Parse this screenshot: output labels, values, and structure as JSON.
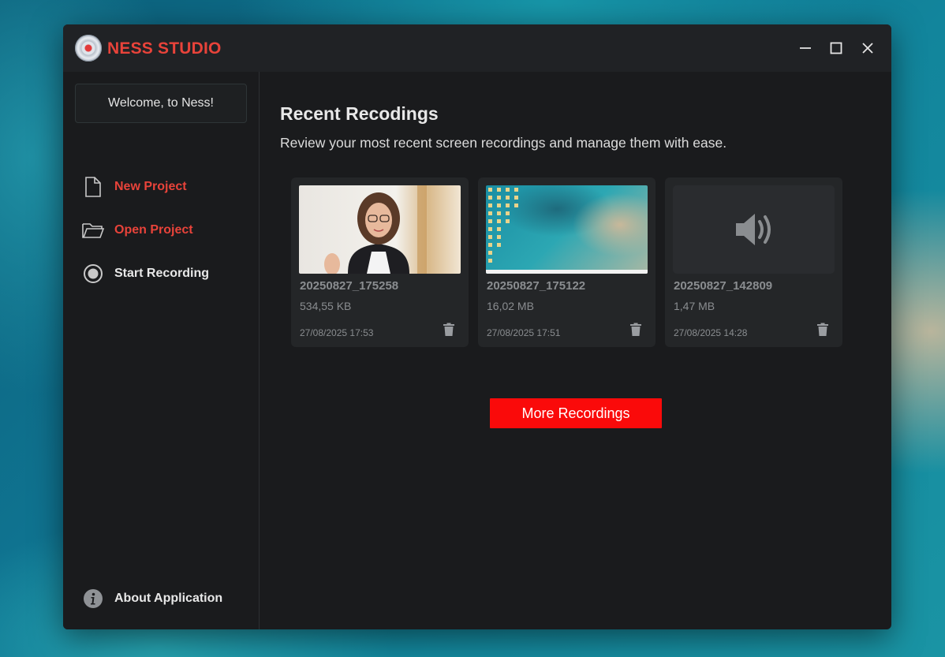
{
  "app": {
    "title": "NESS STUDIO"
  },
  "sidebar": {
    "welcome": "Welcome, to Ness!",
    "items": [
      {
        "label": "New Project",
        "icon": "file-icon"
      },
      {
        "label": "Open Project",
        "icon": "folder-icon"
      },
      {
        "label": "Start Recording",
        "icon": "record-icon"
      }
    ],
    "about": "About Application"
  },
  "main": {
    "title": "Recent Recodings",
    "subtitle": "Review your most recent screen recordings and manage them with ease.",
    "recordings": [
      {
        "name": "20250827_175258",
        "size": "534,55 KB",
        "date": "27/08/2025 17:53",
        "thumbnail": "person-video"
      },
      {
        "name": "20250827_175122",
        "size": "16,02 MB",
        "date": "27/08/2025 17:51",
        "thumbnail": "desktop-screen"
      },
      {
        "name": "20250827_142809",
        "size": "1,47 MB",
        "date": "27/08/2025 14:28",
        "thumbnail": "audio-speaker-icon"
      }
    ],
    "more_button": "More Recordings"
  },
  "colors": {
    "accent": "#e8433a",
    "button": "#fa0a0a",
    "background": "#1a1b1d",
    "card": "#242628"
  }
}
